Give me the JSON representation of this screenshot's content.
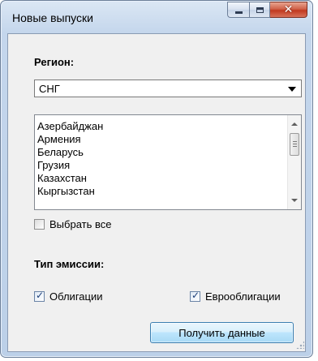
{
  "window": {
    "title": "Новые выпуски",
    "controls": {
      "minimize_icon": "minimize-icon",
      "maximize_icon": "maximize-icon",
      "close_icon": "close-icon"
    }
  },
  "region": {
    "label": "Регион:",
    "selected": "СНГ",
    "list": [
      "Азербайджан",
      "Армения",
      "Беларусь",
      "Грузия",
      "Казахстан",
      "Кыргызстан"
    ],
    "select_all_label": "Выбрать все",
    "select_all_checked": false
  },
  "emission": {
    "label": "Тип эмиссии:",
    "bonds_label": "Облигации",
    "bonds_checked": true,
    "eurobonds_label": "Еврооблигации",
    "eurobonds_checked": true
  },
  "actions": {
    "get_data_label": "Получить данные"
  }
}
